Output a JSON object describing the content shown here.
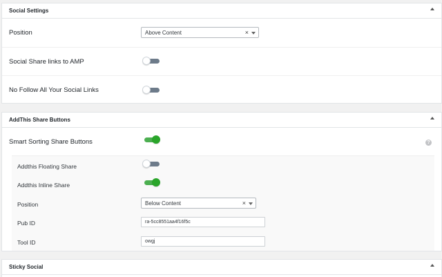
{
  "social_settings": {
    "title": "Social Settings",
    "position_label": "Position",
    "position_value": "Above Content",
    "amp_label": "Social Share links to AMP",
    "amp_enabled": false,
    "nofollow_label": "No Follow All Your Social Links",
    "nofollow_enabled": false
  },
  "addthis": {
    "title": "AddThis Share Buttons",
    "smart_sorting_label": "Smart Sorting Share Buttons",
    "smart_sorting_enabled": true,
    "floating_label": "Addthis Floating Share",
    "floating_enabled": false,
    "inline_label": "Addthis Inline Share",
    "inline_enabled": true,
    "position_label": "Position",
    "position_value": "Below Content",
    "pub_id_label": "Pub ID",
    "pub_id_value": "ra-5cc8551aa4f16f5c",
    "tool_id_label": "Tool ID",
    "tool_id_value": "owgj",
    "help_glyph": "?"
  },
  "sticky_social": {
    "title": "Sticky Social"
  },
  "icons": {
    "clear": "×",
    "collapse": "caret-up-icon",
    "dropdown": "chevron-down-icon",
    "help": "question-icon"
  }
}
